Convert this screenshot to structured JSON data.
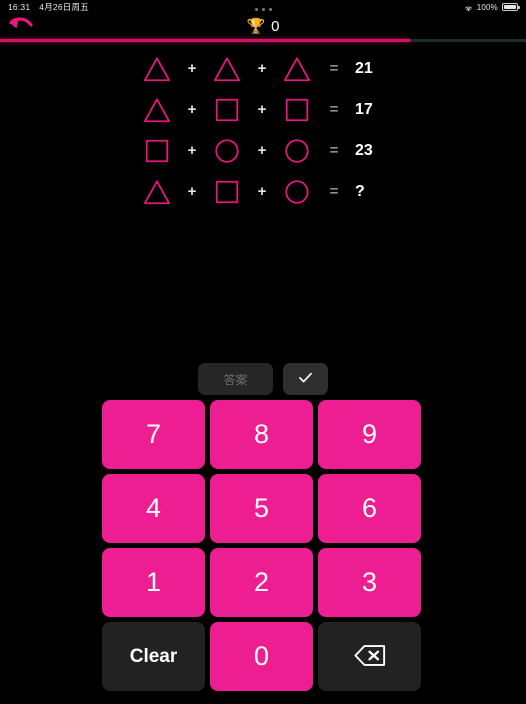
{
  "statusbar": {
    "time": "16:31",
    "date": "4月26日周五",
    "battery_percent": "100%",
    "wifi_icon": "wifi-icon",
    "battery_icon": "battery-icon"
  },
  "header": {
    "back_icon": "back-arrow-icon",
    "trophy_icon": "🏆",
    "score": "0",
    "multitask_icon": "multitask-dots-icon"
  },
  "progress": {
    "percent": 78,
    "fill_color": "#d4145a",
    "track_color": "#1b2b2b"
  },
  "puzzle": {
    "shape_color": "#e6187f",
    "equations": [
      {
        "terms": [
          "triangle",
          "triangle",
          "triangle"
        ],
        "operators": [
          "+",
          "+"
        ],
        "equals": "=",
        "result": "21"
      },
      {
        "terms": [
          "triangle",
          "square",
          "square"
        ],
        "operators": [
          "+",
          "+"
        ],
        "equals": "=",
        "result": "17"
      },
      {
        "terms": [
          "square",
          "circle",
          "circle"
        ],
        "operators": [
          "+",
          "+"
        ],
        "equals": "=",
        "result": "23"
      },
      {
        "terms": [
          "triangle",
          "square",
          "circle"
        ],
        "operators": [
          "+",
          "+"
        ],
        "equals": "=",
        "result": "?"
      }
    ]
  },
  "actions": {
    "answer_label": "答案",
    "check_icon": "checkmark-icon"
  },
  "keypad": {
    "accent_color": "#ed1e92",
    "keys": [
      {
        "label": "7",
        "type": "num"
      },
      {
        "label": "8",
        "type": "num"
      },
      {
        "label": "9",
        "type": "num"
      },
      {
        "label": "4",
        "type": "num"
      },
      {
        "label": "5",
        "type": "num"
      },
      {
        "label": "6",
        "type": "num"
      },
      {
        "label": "1",
        "type": "num"
      },
      {
        "label": "2",
        "type": "num"
      },
      {
        "label": "3",
        "type": "num"
      },
      {
        "label": "Clear",
        "type": "dark"
      },
      {
        "label": "0",
        "type": "num"
      },
      {
        "label": "",
        "type": "backspace",
        "icon": "backspace-icon"
      }
    ]
  }
}
